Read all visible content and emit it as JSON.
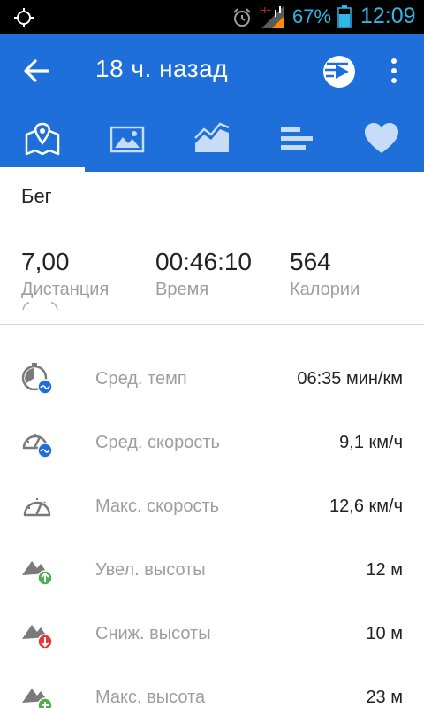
{
  "status_bar": {
    "network_type": "H+",
    "battery_percent": "67%",
    "time": "12:09",
    "icons": [
      "location-target-icon",
      "alarm-clock-icon",
      "signal-icon",
      "battery-icon"
    ],
    "color": "#33b5e5"
  },
  "app_bar": {
    "title": "18 ч. назад",
    "background": "#1e6fd9",
    "icons": [
      "back-arrow-icon",
      "play-video-icon",
      "more-vertical-icon"
    ]
  },
  "tabs": [
    {
      "name": "map",
      "icon": "map-pin-icon",
      "selected": true
    },
    {
      "name": "photos",
      "icon": "image-icon",
      "selected": false
    },
    {
      "name": "charts",
      "icon": "area-chart-icon",
      "selected": false
    },
    {
      "name": "splits",
      "icon": "bars-icon",
      "selected": false
    },
    {
      "name": "heart-rate",
      "icon": "heart-icon",
      "selected": false
    }
  ],
  "activity": {
    "type": "Бег"
  },
  "summary": [
    {
      "value": "7,00",
      "label": "Дистанция"
    },
    {
      "value": "00:46:10",
      "label": "Время"
    },
    {
      "value": "564",
      "label": "Калории"
    }
  ],
  "stats": [
    {
      "icon": "avg-pace-icon",
      "label": "Сред. темп",
      "value": "06:35 мин/км"
    },
    {
      "icon": "avg-speed-icon",
      "label": "Сред. скорость",
      "value": "9,1 км/ч"
    },
    {
      "icon": "max-speed-icon",
      "label": "Макс. скорость",
      "value": "12,6 км/ч"
    },
    {
      "icon": "elevation-gain-icon",
      "label": "Увел. высоты",
      "value": "12 м"
    },
    {
      "icon": "elevation-loss-icon",
      "label": "Сниж. высоты",
      "value": "10 м"
    },
    {
      "icon": "max-elevation-icon",
      "label": "Макс. высота",
      "value": "23 м"
    }
  ],
  "colors": {
    "accent": "#1e6fd9",
    "gain": "#4caf50",
    "loss": "#e53935",
    "badge": "#1e6fd9",
    "icon_gray": "#7a7a7a"
  }
}
